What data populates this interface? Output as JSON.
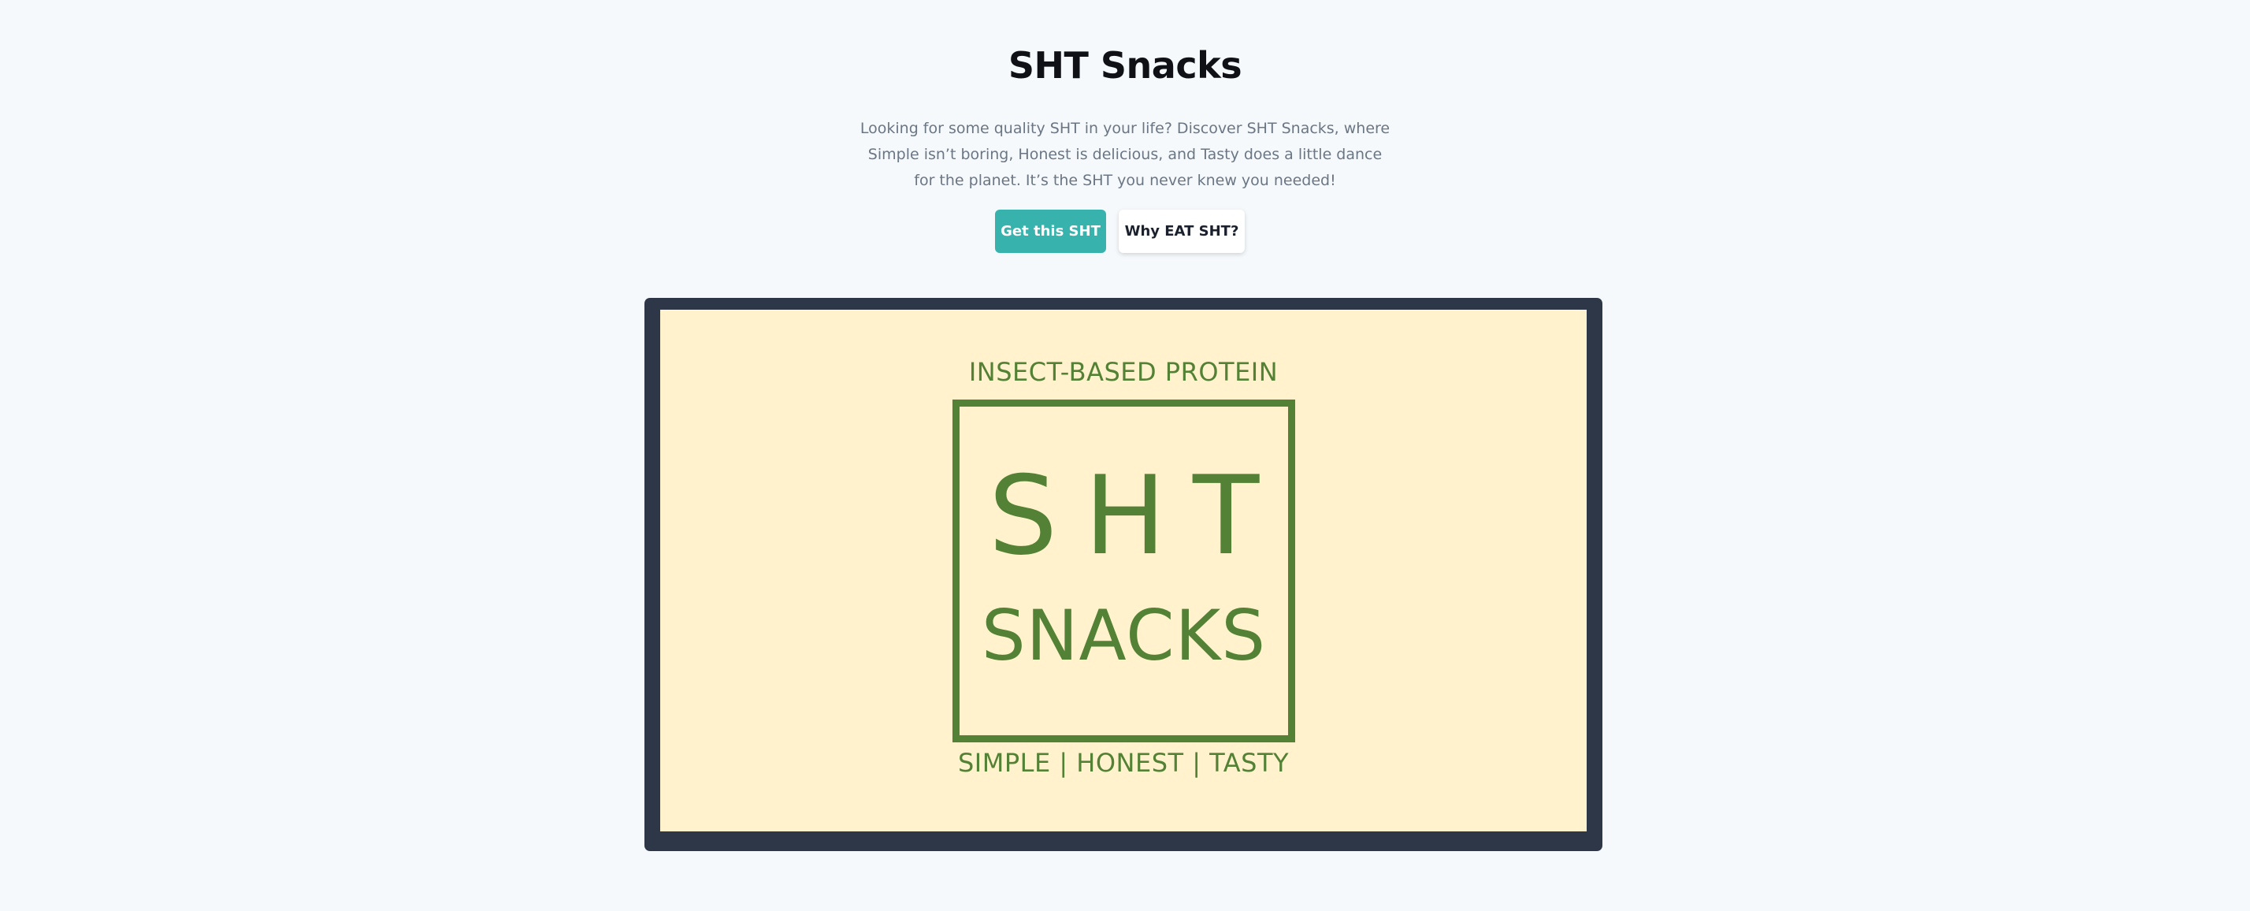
{
  "hero": {
    "title": "SHT Snacks",
    "description": "Looking for some quality SHT in your life? Discover SHT Snacks, where Simple isn’t boring, Honest is delicious, and Tasty does a little dance for the planet. It’s the SHT you never knew you needed!",
    "primary_button": "Get this SHT",
    "secondary_button": "Why EAT SHT?"
  },
  "logo": {
    "top_text": "INSECT-BASED PROTEIN",
    "main_text": "SHT",
    "sub_text": "SNACKS",
    "bottom_text": "SIMPLE | HONEST | TASTY"
  },
  "colors": {
    "page_background": "#f5f9fc",
    "primary_button": "#38b2ac",
    "frame": "#2d3748",
    "logo_background": "#fff2cc",
    "logo_green": "#538135"
  }
}
